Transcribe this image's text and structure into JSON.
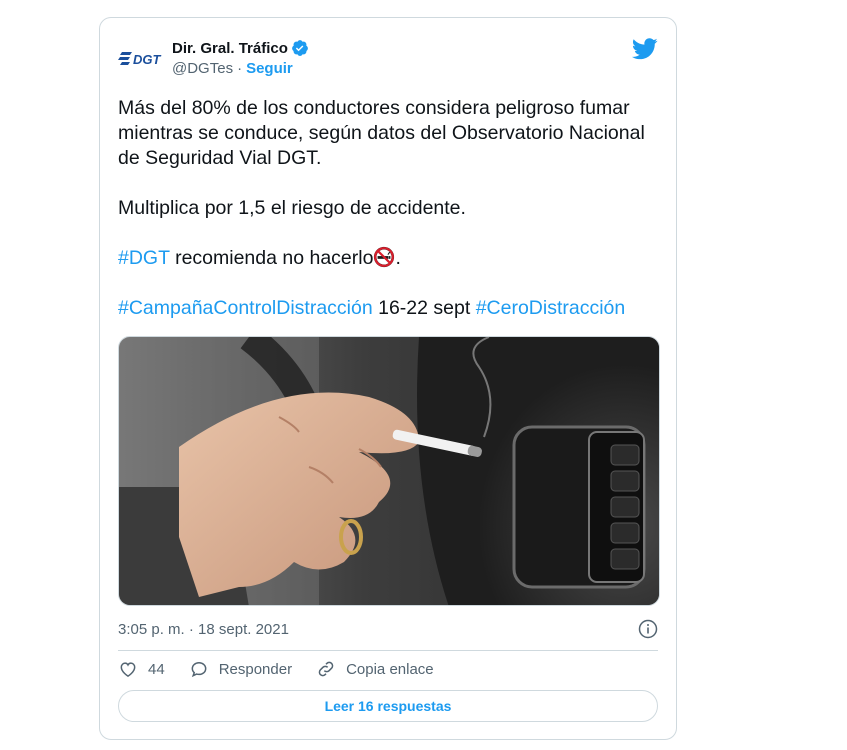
{
  "colors": {
    "accent": "#1d9bf0",
    "text": "#0f1419",
    "secondary": "#536471",
    "border": "#cfd9de"
  },
  "author": {
    "logo_text": "DGT",
    "display_name": "Dir. Gral. Tráfico",
    "verified": true,
    "handle": "@DGTes",
    "separator": "·",
    "follow_label": "Seguir"
  },
  "tweet": {
    "line1": "Más del 80% de los conductores considera peligroso fumar mientras se conduce, según datos del Observatorio Nacional de Seguridad Vial DGT.",
    "line2": "Multiplica por 1,5 el riesgo de accidente.",
    "line3_tag": "#DGT",
    "line3_text": " recomienda no hacerlo",
    "line3_emoji": "no-smoking-icon",
    "line3_end": ".",
    "line4_tag1": "#CampañaControlDistracción",
    "line4_text": " 16-22 sept ",
    "line4_tag2": "#CeroDistracción"
  },
  "media": {
    "description_icon": "photo-hand-holding-cigarette-in-car"
  },
  "meta": {
    "timestamp": "3:05 p. m. · 18 sept. 2021",
    "info_icon": "info-icon"
  },
  "actions": {
    "like_count": "44",
    "reply_label": "Responder",
    "copy_link_label": "Copia enlace"
  },
  "read_replies_label": "Leer 16 respuestas"
}
